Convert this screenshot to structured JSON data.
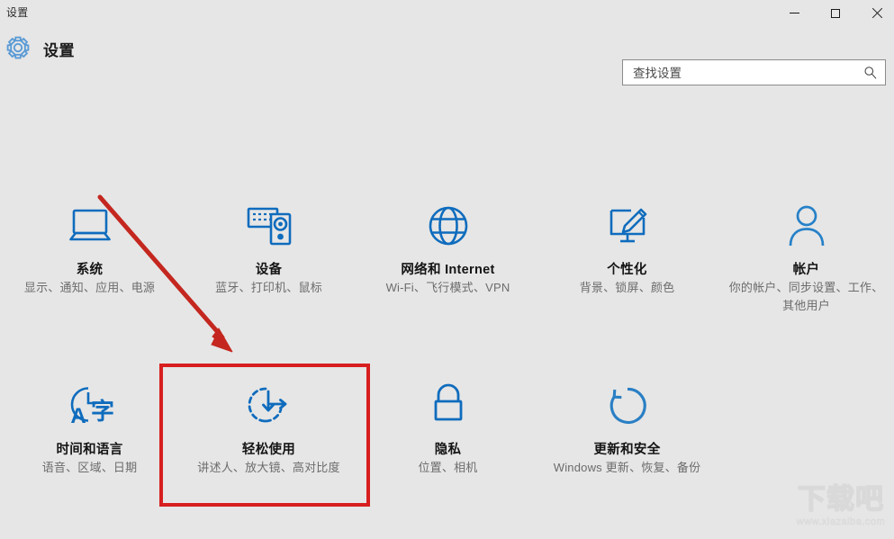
{
  "window": {
    "title_bar_label": "设置",
    "controls": {
      "minimize": "minimize-icon",
      "maximize": "maximize-icon",
      "close": "close-icon"
    }
  },
  "header": {
    "icon": "gear-icon",
    "title": "设置"
  },
  "search": {
    "placeholder": "查找设置",
    "value": "",
    "icon": "search-icon"
  },
  "tiles": [
    {
      "id": "system",
      "icon": "laptop-icon",
      "title": "系统",
      "subtitle": "显示、通知、应用、电源"
    },
    {
      "id": "devices",
      "icon": "keyboard-device-icon",
      "title": "设备",
      "subtitle": "蓝牙、打印机、鼠标"
    },
    {
      "id": "network",
      "icon": "globe-icon",
      "title": "网络和 Internet",
      "subtitle": "Wi-Fi、飞行模式、VPN"
    },
    {
      "id": "personalization",
      "icon": "monitor-brush-icon",
      "title": "个性化",
      "subtitle": "背景、锁屏、颜色"
    },
    {
      "id": "accounts",
      "icon": "person-icon",
      "title": "帐户",
      "subtitle": "你的帐户、同步设置、工作、其他用户"
    },
    {
      "id": "time-language",
      "icon": "clock-language-icon",
      "title": "时间和语言",
      "subtitle": "语音、区域、日期"
    },
    {
      "id": "ease-of-access",
      "icon": "ease-of-access-icon",
      "title": "轻松使用",
      "subtitle": "讲述人、放大镜、高对比度"
    },
    {
      "id": "privacy",
      "icon": "lock-icon",
      "title": "隐私",
      "subtitle": "位置、相机"
    },
    {
      "id": "update-security",
      "icon": "refresh-circle-icon",
      "title": "更新和安全",
      "subtitle": "Windows 更新、恢复、备份"
    }
  ],
  "annotations": {
    "highlight_target": "ease-of-access",
    "highlight_color": "#d81f1f",
    "arrow_color": "#c4271f"
  },
  "watermark": {
    "text": "下载吧",
    "url": "www.xiazaiba.com"
  },
  "colors": {
    "background": "#e6e6e6",
    "tile_icon_blue": "#0f6cbd",
    "title_text": "#141414",
    "subtitle_text": "#6c6c6c"
  }
}
